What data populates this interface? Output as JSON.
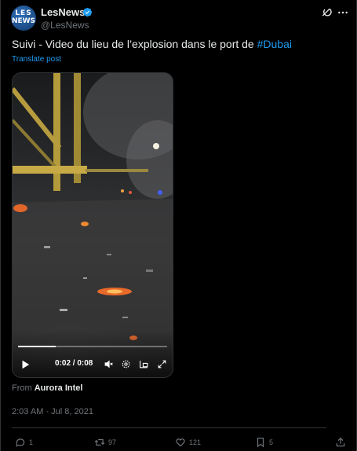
{
  "post": {
    "author_name": "LesNews",
    "handle": "@LesNews",
    "avatar_text_top": "LES",
    "avatar_text_bottom": "NEWS",
    "text": "Suivi - Video du lieu de l’explosion dans le port de ",
    "hashtag": "#Dubai",
    "translate_label": "Translate post",
    "from_prefix": "From",
    "from_source": "Aurora Intel",
    "timestamp": "2:03 AM · Jul 8, 2021"
  },
  "video": {
    "time_display": "0:02 / 0:08",
    "progress_fraction": 0.25
  },
  "actions": {
    "replies": "1",
    "reposts": "97",
    "likes": "121",
    "bookmarks": "5"
  },
  "colors": {
    "accent": "#1d9bf0",
    "muted": "#71767b",
    "text": "#e7e9ea",
    "background": "#000000"
  },
  "icons": [
    "verified-badge-icon",
    "grok-icon",
    "more-icon",
    "play-icon",
    "volume-icon",
    "settings-icon",
    "pip-icon",
    "fullscreen-icon",
    "reply-icon",
    "repost-icon",
    "like-icon",
    "bookmark-icon",
    "share-icon"
  ]
}
